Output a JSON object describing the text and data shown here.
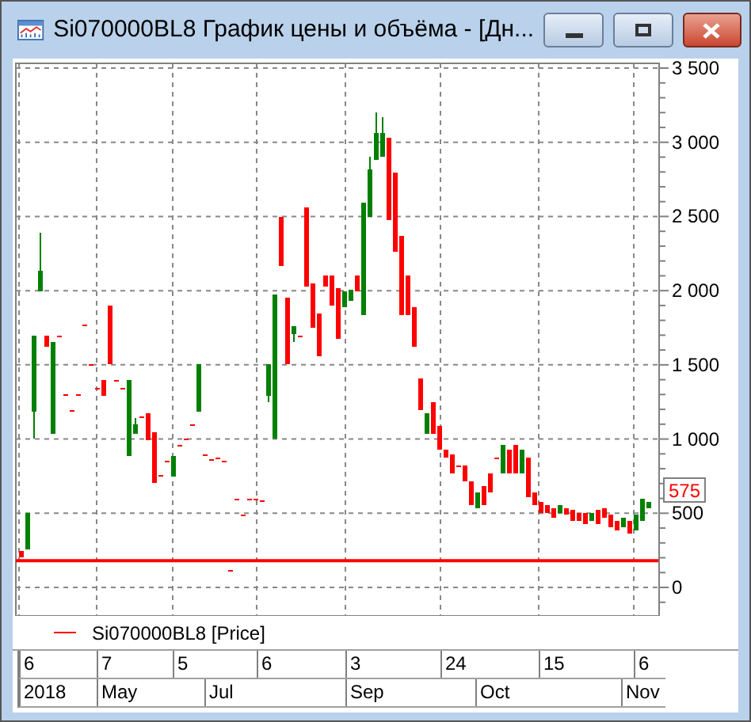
{
  "window": {
    "title": "Si070000BL8 График цены и объёма - [Дн..."
  },
  "chart": {
    "chart_data": {
      "type": "candlestick",
      "categories": [
        null,
        null,
        null,
        null,
        null,
        null,
        null,
        null,
        null,
        null,
        null,
        null,
        null,
        null,
        null,
        null,
        null,
        null,
        null,
        null,
        null,
        null,
        null,
        null,
        null,
        null,
        null,
        null,
        null,
        null,
        null,
        null,
        null,
        null,
        null,
        null,
        null,
        null,
        null,
        null,
        null,
        null,
        null,
        null,
        null,
        null,
        null,
        null,
        null,
        null,
        null,
        null,
        null,
        null,
        null,
        null,
        null,
        null,
        null,
        null,
        null,
        null,
        null,
        null,
        null,
        null,
        null,
        null,
        null,
        null,
        null,
        null,
        null,
        null,
        null,
        null,
        null,
        null,
        null,
        null,
        null,
        null,
        null,
        null,
        null,
        null,
        null,
        null,
        null,
        null,
        null,
        null,
        null,
        null,
        null,
        null,
        null,
        null,
        null,
        null
      ],
      "ylim": [
        -192,
        3532
      ],
      "grid": true,
      "ref_lines": [
        {
          "axis": "y",
          "value": 180,
          "color": "#ff0000"
        }
      ],
      "ohlc": [
        [
          245,
          245,
          205,
          205
        ],
        [
          255,
          500,
          255,
          500
        ],
        [
          1185,
          1695,
          1005,
          1695
        ],
        [
          1995,
          2390,
          1995,
          2135
        ],
        [
          1695,
          1695,
          1620,
          1620
        ],
        [
          1035,
          1655,
          1035,
          1655
        ],
        [
          1695,
          1695,
          1685,
          1685
        ],
        [
          1300,
          1300,
          1290,
          1290
        ],
        [
          1195,
          1195,
          1185,
          1185
        ],
        [
          1300,
          1300,
          1290,
          1290
        ],
        [
          1770,
          1770,
          1760,
          1760
        ],
        [
          1505,
          1505,
          1495,
          1495
        ],
        [
          1345,
          1345,
          1335,
          1335
        ],
        [
          1400,
          1400,
          1290,
          1290
        ],
        [
          1900,
          1900,
          1505,
          1505
        ],
        [
          1400,
          1400,
          1385,
          1385
        ],
        [
          1345,
          1345,
          1335,
          1335
        ],
        [
          885,
          1400,
          885,
          1400
        ],
        [
          1035,
          1140,
          1035,
          1100
        ],
        [
          1150,
          1150,
          1140,
          1140
        ],
        [
          1175,
          1175,
          990,
          990
        ],
        [
          1045,
          1045,
          705,
          705
        ],
        [
          760,
          760,
          745,
          745
        ],
        [
          855,
          855,
          845,
          845
        ],
        [
          745,
          885,
          745,
          885
        ],
        [
          960,
          960,
          950,
          950
        ],
        [
          1005,
          1005,
          990,
          990
        ],
        [
          1100,
          1100,
          1090,
          1090
        ],
        [
          1185,
          1505,
          1185,
          1505
        ],
        [
          895,
          895,
          885,
          885
        ],
        [
          865,
          865,
          855,
          855
        ],
        [
          875,
          875,
          865,
          865
        ],
        [
          855,
          855,
          845,
          845
        ],
        [
          115,
          115,
          105,
          105
        ],
        [
          600,
          600,
          585,
          585
        ],
        [
          490,
          490,
          480,
          480
        ],
        [
          600,
          600,
          585,
          585
        ],
        [
          600,
          600,
          585,
          585
        ],
        [
          585,
          585,
          575,
          575
        ],
        [
          1290,
          1505,
          1250,
          1505
        ],
        [
          1005,
          1975,
          1005,
          1975
        ],
        [
          2495,
          2495,
          2165,
          2165
        ],
        [
          1955,
          1955,
          1505,
          1505
        ],
        [
          1705,
          1760,
          1655,
          1760
        ],
        [
          1695,
          1695,
          1685,
          1685
        ],
        [
          2560,
          2560,
          2030,
          2030
        ],
        [
          2050,
          2050,
          1750,
          1750
        ],
        [
          1845,
          1845,
          1560,
          1560
        ],
        [
          2100,
          2100,
          2030,
          2030
        ],
        [
          2100,
          2100,
          1900,
          1900
        ],
        [
          2015,
          2015,
          1675,
          1675
        ],
        [
          1890,
          1995,
          1890,
          1995
        ],
        [
          1930,
          2005,
          1930,
          2005
        ],
        [
          2100,
          2100,
          1995,
          1995
        ],
        [
          1835,
          2595,
          1835,
          2595
        ],
        [
          2495,
          2905,
          2495,
          2815
        ],
        [
          2880,
          3200,
          2880,
          3065
        ],
        [
          2905,
          3170,
          2905,
          3065
        ],
        [
          3030,
          3030,
          2475,
          2475
        ],
        [
          2795,
          2795,
          2260,
          2260
        ],
        [
          2370,
          2370,
          1835,
          1835
        ],
        [
          2100,
          2100,
          1835,
          1835
        ],
        [
          1890,
          1890,
          1620,
          1620
        ],
        [
          1410,
          1410,
          1195,
          1195
        ],
        [
          1035,
          1175,
          1035,
          1175
        ],
        [
          1250,
          1250,
          1035,
          1035
        ],
        [
          1090,
          1090,
          930,
          930
        ],
        [
          930,
          930,
          875,
          875
        ],
        [
          895,
          895,
          770,
          770
        ],
        [
          820,
          820,
          810,
          810
        ],
        [
          820,
          820,
          715,
          715
        ],
        [
          715,
          715,
          555,
          555
        ],
        [
          535,
          640,
          535,
          640
        ],
        [
          685,
          685,
          555,
          555
        ],
        [
          770,
          770,
          640,
          640
        ],
        [
          875,
          875,
          865,
          865
        ],
        [
          770,
          960,
          770,
          960
        ],
        [
          930,
          930,
          770,
          770
        ],
        [
          960,
          960,
          770,
          770
        ],
        [
          770,
          930,
          770,
          930
        ],
        [
          875,
          875,
          610,
          610
        ],
        [
          640,
          640,
          555,
          555
        ],
        [
          575,
          575,
          500,
          500
        ],
        [
          555,
          555,
          500,
          500
        ],
        [
          535,
          535,
          470,
          470
        ],
        [
          500,
          555,
          500,
          555
        ],
        [
          535,
          535,
          490,
          490
        ],
        [
          525,
          525,
          450,
          450
        ],
        [
          500,
          500,
          450,
          450
        ],
        [
          500,
          500,
          425,
          425
        ],
        [
          450,
          500,
          450,
          500
        ],
        [
          525,
          525,
          425,
          425
        ],
        [
          535,
          535,
          470,
          470
        ],
        [
          490,
          490,
          405,
          405
        ],
        [
          450,
          450,
          385,
          385
        ],
        [
          405,
          470,
          405,
          470
        ],
        [
          450,
          450,
          365,
          365
        ],
        [
          385,
          490,
          385,
          490
        ],
        [
          450,
          600,
          450,
          600
        ],
        [
          535,
          575,
          535,
          575
        ]
      ],
      "yticks": [
        {
          "value": 3500,
          "label": "3 500"
        },
        {
          "value": 3000,
          "label": "3 000"
        },
        {
          "value": 2500,
          "label": "2 500"
        },
        {
          "value": 2000,
          "label": "2 000"
        },
        {
          "value": 1500,
          "label": "1 500"
        },
        {
          "value": 1000,
          "label": "1 000"
        },
        {
          "value": 500,
          "label": "500"
        },
        {
          "value": 0,
          "label": "0"
        }
      ]
    },
    "last_price": "575"
  },
  "legend": [
    {
      "label": "Si070000BL8 [Price]",
      "color": "#ff0000"
    }
  ],
  "date_rows": [
    [
      "6",
      "7",
      "5",
      "6",
      "3",
      "24",
      "15",
      "6"
    ],
    [
      "2018",
      "May",
      "Jul",
      "Sep",
      "Oct",
      "Nov"
    ]
  ]
}
